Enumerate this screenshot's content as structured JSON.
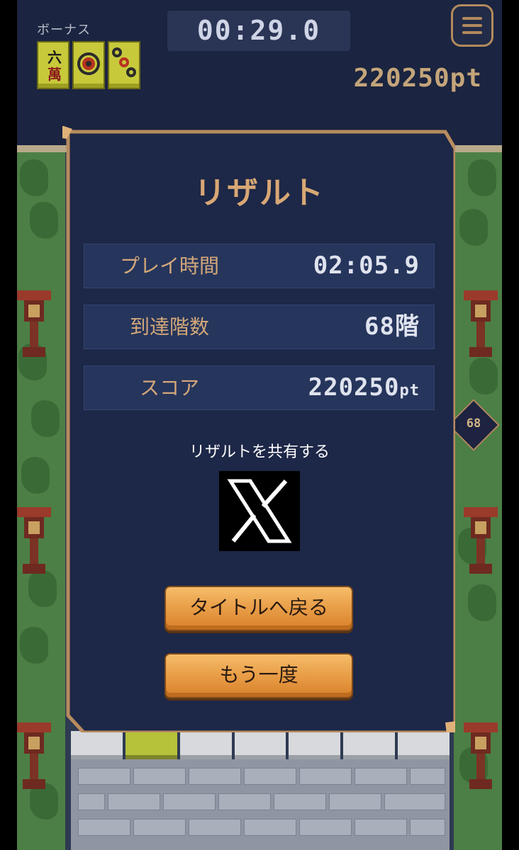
{
  "hud": {
    "bonus_label": "ボーナス",
    "bonus_tiles": [
      "six-wan-tile",
      "circle-one-tile",
      "circle-three-tile"
    ],
    "timer": "00:29.0",
    "score": "220250pt",
    "menu_icon": "hamburger-menu-icon"
  },
  "floor_marker": "68",
  "result": {
    "title": "リザルト",
    "rows": [
      {
        "label": "プレイ時間",
        "value": "02:05.9"
      },
      {
        "label": "到達階数",
        "value": "68階"
      },
      {
        "label": "スコア",
        "value": "220250",
        "unit": "pt"
      }
    ],
    "share_label": "リザルトを共有する",
    "share_icon": "x-logo-icon",
    "back_button": "タイトルへ戻る",
    "retry_button": "もう一度"
  },
  "colors": {
    "background": "#1b2440",
    "panel": "#1d2747",
    "accent": "#d8a774",
    "button": "#eaa04a",
    "tile_yellow": "#c7c93b"
  }
}
